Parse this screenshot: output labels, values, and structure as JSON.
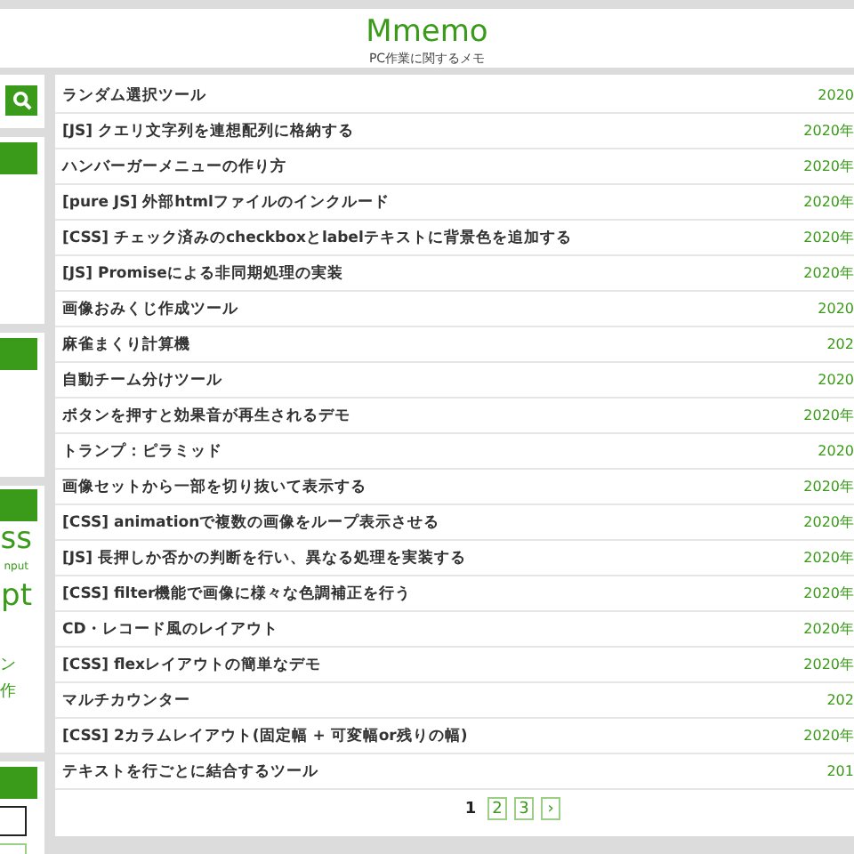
{
  "header": {
    "title": "Mmemo",
    "subtitle": "PC作業に関するメモ"
  },
  "sidebar": [
    {
      "kind": "search"
    },
    {
      "kind": "box"
    },
    {
      "kind": "box"
    },
    {
      "kind": "tags",
      "items": [
        {
          "kind": "large",
          "text": "ss"
        },
        {
          "kind": "small",
          "text": "nput"
        },
        {
          "kind": "large",
          "text": "pt"
        },
        {
          "kind": "spacer"
        },
        {
          "kind": "medium",
          "text": "ン"
        },
        {
          "kind": "medium",
          "text": "作"
        }
      ]
    },
    {
      "kind": "form"
    }
  ],
  "posts": [
    {
      "title": "ランダム選択ツール",
      "date": "2020"
    },
    {
      "title": "[JS] クエリ文字列を連想配列に格納する",
      "date": "2020年"
    },
    {
      "title": "ハンバーガーメニューの作り方",
      "date": "2020年"
    },
    {
      "title": "[pure JS] 外部htmlファイルのインクルード",
      "date": "2020年"
    },
    {
      "title": "[CSS] チェック済みのcheckboxとlabelテキストに背景色を追加する",
      "date": "2020年"
    },
    {
      "title": "[JS] Promiseによる非同期処理の実装",
      "date": "2020年"
    },
    {
      "title": "画像おみくじ作成ツール",
      "date": "2020"
    },
    {
      "title": "麻雀まくり計算機",
      "date": "202"
    },
    {
      "title": "自動チーム分けツール",
      "date": "2020"
    },
    {
      "title": "ボタンを押すと効果音が再生されるデモ",
      "date": "2020年"
    },
    {
      "title": "トランプ：ピラミッド",
      "date": "2020"
    },
    {
      "title": "画像セットから一部を切り抜いて表示する",
      "date": "2020年"
    },
    {
      "title": "[CSS] animationで複数の画像をループ表示させる",
      "date": "2020年"
    },
    {
      "title": "[JS] 長押しか否かの判断を行い、異なる処理を実装する",
      "date": "2020年"
    },
    {
      "title": "[CSS] filter機能で画像に様々な色調補正を行う",
      "date": "2020年"
    },
    {
      "title": "CD・レコード風のレイアウト",
      "date": "2020年"
    },
    {
      "title": "[CSS] flexレイアウトの簡単なデモ",
      "date": "2020年"
    },
    {
      "title": "マルチカウンター",
      "date": "202"
    },
    {
      "title": "[CSS] 2カラムレイアウト(固定幅 + 可変幅or残りの幅)",
      "date": "2020年"
    },
    {
      "title": "テキストを行ごとに結合するツール",
      "date": "201"
    }
  ],
  "pagination": [
    {
      "label": "1",
      "selected": true
    },
    {
      "label": "2",
      "selected": false
    },
    {
      "label": "3",
      "selected": false
    },
    {
      "label": "›",
      "selected": false
    }
  ]
}
